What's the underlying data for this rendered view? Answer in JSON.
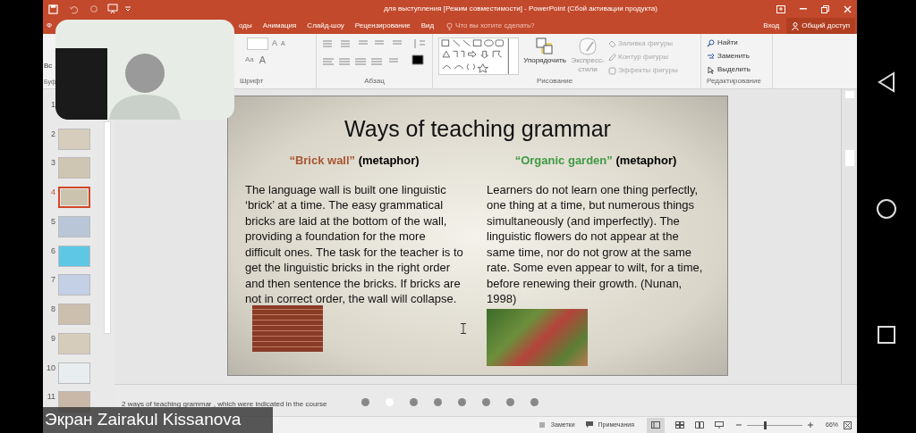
{
  "window": {
    "title": "для  выступления [Режим совместимости] - PowerPoint (Сбой активации продукта)"
  },
  "tabs": [
    {
      "label": "Ф",
      "selected": false
    },
    {
      "label": "оды",
      "selected": false
    },
    {
      "label": "Анимация",
      "selected": false
    },
    {
      "label": "Слайд-шоу",
      "selected": false
    },
    {
      "label": "Рецензирование",
      "selected": false
    },
    {
      "label": "Вид",
      "selected": false
    }
  ],
  "tell_me": "Что вы хотите сделать?",
  "sign_in": "Вход",
  "share": "Общий доступ",
  "ribbon": {
    "clipboard": {
      "button": "Вс",
      "label": "Буф"
    },
    "font": {
      "grow_font": "A",
      "shrink_font": "A",
      "change_case": "Aa",
      "font_color": "A",
      "label": "Шрифт"
    },
    "paragraph": {
      "label": "Абзац"
    },
    "drawing": {
      "arrange": "Упорядочить",
      "quick_styles": "Экспресс-стили",
      "fill": "Заливка фигуры",
      "outline": "Контур фигуры",
      "effects": "Эффекты фигуры",
      "label": "Рисование"
    },
    "editing": {
      "find": "Найти",
      "replace": "Заменить",
      "select": "Выделить",
      "label": "Редактирование"
    }
  },
  "slides": [
    {
      "number": "1",
      "selected": false
    },
    {
      "number": "2",
      "selected": false,
      "color": "#d6cdbd"
    },
    {
      "number": "3",
      "selected": false,
      "color": "#cfc5b3"
    },
    {
      "number": "4",
      "selected": true,
      "color": "#cbc3ad"
    },
    {
      "number": "5",
      "selected": false,
      "color": "#b9c6d8"
    },
    {
      "number": "6",
      "selected": false,
      "color": "#5fc7e6"
    },
    {
      "number": "7",
      "selected": false,
      "color": "#c3d0e6"
    },
    {
      "number": "8",
      "selected": false,
      "color": "#cdbfae"
    },
    {
      "number": "9",
      "selected": false,
      "color": "#d6ccbc"
    },
    {
      "number": "10",
      "selected": false,
      "color": "#e8eef0"
    },
    {
      "number": "11",
      "selected": false,
      "color": "#c9b7a8"
    }
  ],
  "slide": {
    "title": "Ways of teaching grammar",
    "columns": [
      {
        "quote": "“Brick wall”",
        "color": "#a9552f",
        "rest": "(metaphor)",
        "text": "The language wall is built one linguistic ‘brick’ at a time. The easy grammatical bricks are laid at the bottom of the wall, providing a foundation for the more difficult ones. The task for the teacher is to get the linguistic bricks in the right order and then sentence the bricks. If bricks are not in correct order, the wall will collapse.",
        "kind": "brick"
      },
      {
        "quote": "“Organic garden”",
        "color": "#3f9a45",
        "rest": "(metaphor)",
        "text": "Learners do not learn one thing perfectly, one thing at a time, but numerous things simultaneously (and imperfectly). The linguistic flowers do not appear at the same time, nor do not grow at the same rate. Some even appear to wilt, for a time, before renewing their growth. (Nunan, 1998)",
        "kind": "garden"
      }
    ]
  },
  "notes": "2 ways of teaching grammar , which were indicated in the course",
  "page_dots": [
    {
      "selected": false
    },
    {
      "selected": true
    },
    {
      "selected": false
    },
    {
      "selected": false
    },
    {
      "selected": false
    },
    {
      "selected": false
    },
    {
      "selected": false
    },
    {
      "selected": false
    }
  ],
  "status_bar": {
    "notes": "Заметки",
    "comments": "Примечания",
    "zoom": {
      "level": 0.33
    },
    "zoom_value": "66%"
  },
  "caption": "Экран Zairakul  Kissanova"
}
